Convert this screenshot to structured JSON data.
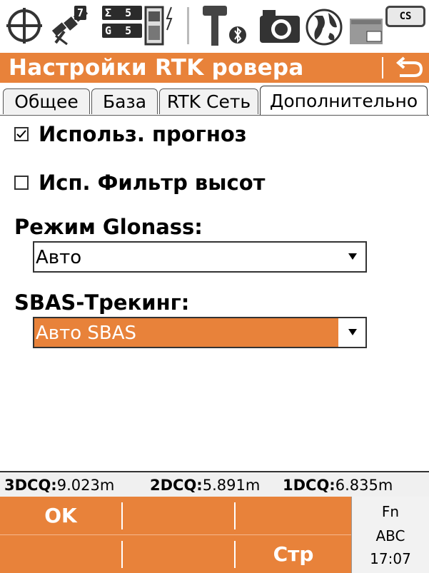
{
  "status_bar": {
    "icons": [
      "crosshair-icon",
      "satellite-icon",
      "battery-icon",
      "radio-antenna-icon",
      "bluetooth-icon",
      "camera-icon",
      "globe-icon",
      "sd-card-icon"
    ],
    "sat_visible": "7",
    "sigma_label": "Σ",
    "sigma_count": "5",
    "glonass_label": "G",
    "glonass_count": "5",
    "cs_badge": "CS"
  },
  "title_bar": {
    "title": "Настройки RTK ровера",
    "back_icon": "back-arrow-icon"
  },
  "tabs": [
    {
      "label": "Общее",
      "active": false
    },
    {
      "label": "База",
      "active": false
    },
    {
      "label": "RTK Сеть",
      "active": false
    },
    {
      "label": "Дополнительно",
      "active": true
    }
  ],
  "content": {
    "use_prediction": {
      "label": "Использ. прогноз",
      "checked": true
    },
    "height_filter": {
      "label": "Исп. Фильтр высот",
      "checked": false
    },
    "glonass_mode": {
      "label": "Режим Glonass:",
      "value": "Авто"
    },
    "sbas_tracking": {
      "label": "SBAS-Трекинг:",
      "value": "Авто SBAS"
    }
  },
  "info_line": {
    "dcq3_label": "3DCQ:",
    "dcq3_value": "9.023m",
    "dcq2_label": "2DCQ:",
    "dcq2_value": "5.891m",
    "dcq1_label": "1DCQ:",
    "dcq1_value": "6.835m"
  },
  "softkeys": {
    "f1": "OK",
    "f2": "",
    "f3": "",
    "f4": "",
    "f5": "",
    "f6": "Стр"
  },
  "system": {
    "fn": "Fn",
    "input_mode": "ABC",
    "time": "17:07"
  },
  "colors": {
    "accent": "#e8823a",
    "text": "#000000",
    "background": "#ffffff"
  }
}
